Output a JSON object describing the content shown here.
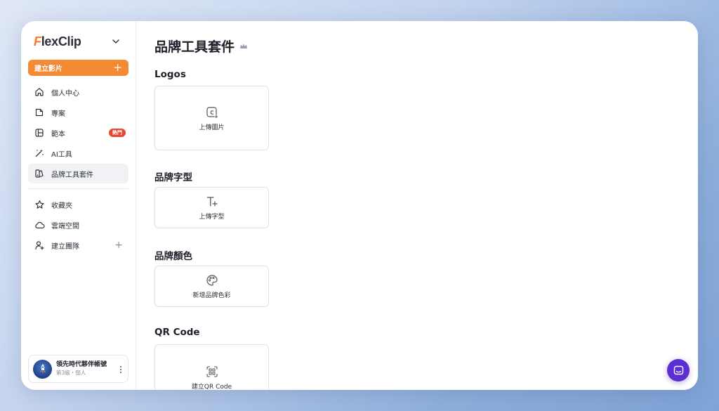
{
  "app": {
    "logo_prefix": "F",
    "logo_rest": "lexClip"
  },
  "sidebar": {
    "create_label": "建立影片",
    "create_plus": "+",
    "items": [
      {
        "label": "個人中心",
        "icon": "home-icon"
      },
      {
        "label": "專案",
        "icon": "folder-icon"
      },
      {
        "label": "範本",
        "icon": "template-icon",
        "badge": "熱門"
      },
      {
        "label": "AI工具",
        "icon": "magic-wand-icon"
      },
      {
        "label": "品牌工具套件",
        "icon": "brand-kit-icon",
        "active": true
      }
    ],
    "items2": [
      {
        "label": "收藏夾",
        "icon": "star-icon"
      },
      {
        "label": "雲端空間",
        "icon": "cloud-icon"
      },
      {
        "label": "建立團隊",
        "icon": "add-user-icon",
        "plus": "+"
      }
    ],
    "user": {
      "name": "領先時代夥伴帳號",
      "subtitle": "第3級・個人"
    }
  },
  "main": {
    "title": "品牌工具套件",
    "sections": [
      {
        "title": "Logos",
        "card_label": "上傳圖片",
        "icon": "upload-image-icon"
      },
      {
        "title": "品牌字型",
        "card_label": "上傳字型",
        "icon": "add-font-icon"
      },
      {
        "title": "品牌顏色",
        "card_label": "新增品牌色彩",
        "icon": "palette-icon"
      },
      {
        "title": "QR Code",
        "card_label": "建立QR Code",
        "icon": "qr-code-icon"
      }
    ]
  },
  "colors": {
    "accent": "#f48a34",
    "badge": "#e8472d",
    "chat": "#5b2fd4"
  }
}
